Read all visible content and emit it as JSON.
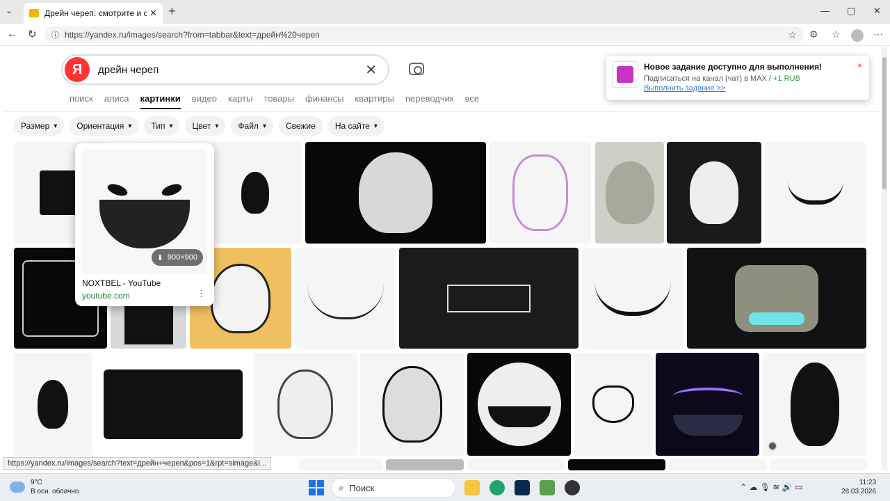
{
  "browser": {
    "tab_title": "Дрейн череп: смотрите и скачив",
    "url": "https://yandex.ru/images/search?from=tabbar&text=дрейн%20череп",
    "status_url": "https://yandex.ru/images/search?text=дрейн+череп&pos=1&rpt=simage&i..."
  },
  "search": {
    "logo_letter": "Я",
    "query": "дрейн череп"
  },
  "services": [
    "поиск",
    "алиса",
    "картинки",
    "видео",
    "карты",
    "товары",
    "финансы",
    "квартиры",
    "переводчик",
    "все"
  ],
  "filters": [
    {
      "label": "Размер"
    },
    {
      "label": "Ориентация"
    },
    {
      "label": "Тип"
    },
    {
      "label": "Цвет"
    },
    {
      "label": "Файл"
    },
    {
      "label": "Свежие"
    },
    {
      "label": "На сайте"
    }
  ],
  "notification": {
    "title": "Новое задание доступно для выполнения!",
    "line": "Подписаться на канал (чат) в MAX /",
    "reward": "+1 RUB",
    "link": "Выполнить задание >>",
    "close": "×"
  },
  "hover_card": {
    "size": "900×900",
    "source": "NOXTBEL - YouTube",
    "domain": "youtube.com"
  },
  "taskbar": {
    "temp": "9°C",
    "weather": "В осн. облачно",
    "search_placeholder": "Поиск",
    "time": "11:23",
    "date": "28.03.2026"
  },
  "icons": {
    "close": "✕",
    "new_tab": "+",
    "back": "←",
    "reload": "↻",
    "star": "☆",
    "clear": "✕",
    "chevron": "⌄",
    "more": "⋮",
    "download": "⬇"
  }
}
